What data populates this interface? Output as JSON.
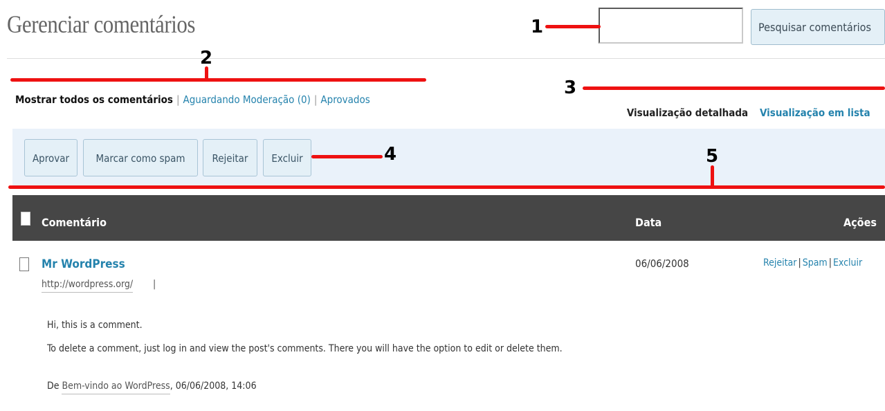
{
  "header": {
    "title": "Gerenciar comentários",
    "search_placeholder": "",
    "search_button": "Pesquisar comentários"
  },
  "annotations": [
    "1",
    "2",
    "3",
    "4",
    "5"
  ],
  "filters": {
    "all": "Mostrar todos os comentários",
    "separator": "|",
    "pending": "Aguardando Moderação (0)",
    "approved": "Aprovados"
  },
  "view_tabs": {
    "detail": "Visualização detalhada",
    "list": "Visualização em lista"
  },
  "bulk_actions": [
    "Aprovar",
    "Marcar como spam",
    "Rejeitar",
    "Excluir"
  ],
  "table": {
    "columns": {
      "comment": "Comentário",
      "date": "Data",
      "actions": "Ações"
    },
    "rows": [
      {
        "author": "Mr WordPress",
        "url": "http://wordpress.org/",
        "url_sep": "|",
        "date": "06/06/2008",
        "actions": [
          "Rejeitar",
          "Spam",
          "Excluir"
        ],
        "action_sep": "|",
        "comment_lines": [
          "Hi, this is a comment.",
          "To delete a comment, just log in and view the post's comments. There you will have the option to edit or delete them."
        ],
        "from_prefix": "De",
        "post_title": "Bem-vindo ao WordPress",
        "posted_at": ", 06/06/2008, 14:06"
      }
    ]
  },
  "colors": {
    "link": "#2583ad",
    "header_bg": "#464646",
    "action_bar_bg": "#eaf2fa",
    "annotation_red": "#ee1111"
  }
}
